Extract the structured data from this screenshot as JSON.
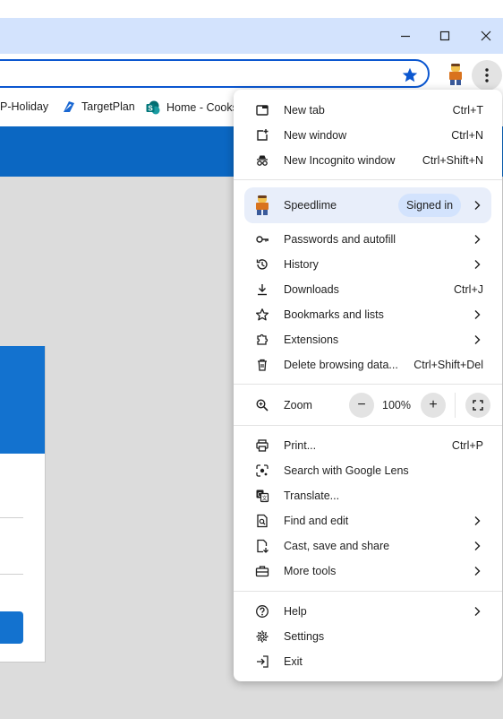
{
  "window": {
    "minimize_icon": "minimize-icon",
    "maximize_icon": "maximize-icon",
    "close_icon": "close-icon"
  },
  "toolbar": {
    "bookmark_star_icon": "star-filled-icon",
    "profile_icon": "lego-avatar-icon",
    "menu_icon": "three-dots-vertical-icon",
    "accent": "#0b57d0"
  },
  "bookmarks": [
    {
      "label": "P-Holiday",
      "icon": ""
    },
    {
      "label": "TargetPlan",
      "icon": "targetplan-icon"
    },
    {
      "label": "Home - Cooks",
      "icon": "sharepoint-icon"
    }
  ],
  "menu": {
    "group1": [
      {
        "label": "New tab",
        "shortcut": "Ctrl+T",
        "icon": "new-tab-icon"
      },
      {
        "label": "New window",
        "shortcut": "Ctrl+N",
        "icon": "new-window-icon"
      },
      {
        "label": "New Incognito window",
        "shortcut": "Ctrl+Shift+N",
        "icon": "incognito-icon"
      }
    ],
    "profile": {
      "name": "Speedlime",
      "status": "Signed in",
      "icon": "lego-avatar-icon"
    },
    "group2": [
      {
        "label": "Passwords and autofill",
        "shortcut": "",
        "icon": "key-icon",
        "submenu": true
      },
      {
        "label": "History",
        "shortcut": "",
        "icon": "history-icon",
        "submenu": true
      },
      {
        "label": "Downloads",
        "shortcut": "Ctrl+J",
        "icon": "download-icon",
        "submenu": false
      },
      {
        "label": "Bookmarks and lists",
        "shortcut": "",
        "icon": "star-outline-icon",
        "submenu": true
      },
      {
        "label": "Extensions",
        "shortcut": "",
        "icon": "puzzle-icon",
        "submenu": true
      },
      {
        "label": "Delete browsing data...",
        "shortcut": "Ctrl+Shift+Del",
        "icon": "trash-icon",
        "submenu": false
      }
    ],
    "zoom": {
      "label": "Zoom",
      "value": "100%",
      "minus": "−",
      "plus": "+"
    },
    "group3": [
      {
        "label": "Print...",
        "shortcut": "Ctrl+P",
        "icon": "print-icon",
        "submenu": false
      },
      {
        "label": "Search with Google Lens",
        "shortcut": "",
        "icon": "lens-icon",
        "submenu": false
      },
      {
        "label": "Translate...",
        "shortcut": "",
        "icon": "translate-icon",
        "submenu": false
      },
      {
        "label": "Find and edit",
        "shortcut": "",
        "icon": "find-icon",
        "submenu": true
      },
      {
        "label": "Cast, save and share",
        "shortcut": "",
        "icon": "cast-save-icon",
        "submenu": true
      },
      {
        "label": "More tools",
        "shortcut": "",
        "icon": "toolbox-icon",
        "submenu": true
      }
    ],
    "group4": [
      {
        "label": "Help",
        "shortcut": "",
        "icon": "help-icon",
        "submenu": true
      },
      {
        "label": "Settings",
        "shortcut": "",
        "icon": "settings-gear-icon",
        "submenu": false
      },
      {
        "label": "Exit",
        "shortcut": "",
        "icon": "exit-icon",
        "submenu": false
      }
    ]
  }
}
